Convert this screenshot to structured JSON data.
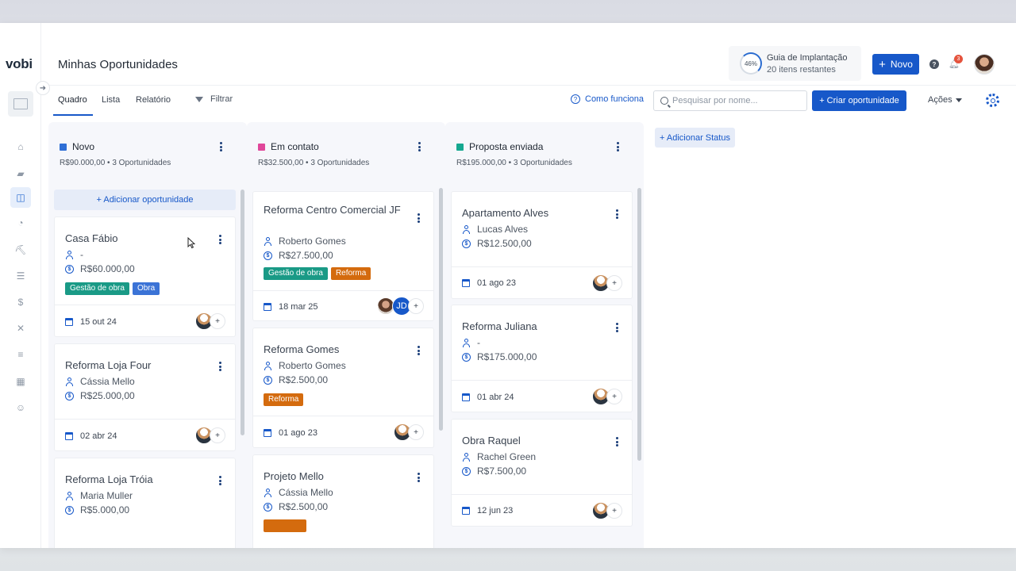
{
  "app": {
    "logo": "vobi",
    "page_title": "Minhas Oportunidades"
  },
  "guide": {
    "percent": "46%",
    "progress": 0.46,
    "title": "Guia de Implantação",
    "subtitle": "20 itens restantes"
  },
  "header": {
    "new_button": "Novo",
    "new_icon": "+",
    "help_icon": "?",
    "notification_count": "3"
  },
  "tabs": [
    {
      "label": "Quadro",
      "active": true
    },
    {
      "label": "Lista",
      "active": false
    },
    {
      "label": "Relatório",
      "active": false
    }
  ],
  "toolbar": {
    "filter_label": "Filtrar",
    "how_label": "Como funciona",
    "search_placeholder": "Pesquisar por nome...",
    "search_value": "",
    "create_label": "+ Criar oportunidade",
    "actions_label": "Ações"
  },
  "add_status_label": "+ Adicionar Status",
  "add_opportunity_label": "+ Adicionar oportunidade",
  "columns": [
    {
      "title": "Novo",
      "color": "#2f6fd6",
      "summary": "R$90.000,00 • 3 Oportunidades",
      "cards": [
        {
          "title": "Casa Fábio",
          "person": "-",
          "value": "R$60.000,00",
          "tags": [
            "Gestão de obra",
            "Obra"
          ],
          "date": "15 out 24"
        },
        {
          "title": "Reforma Loja Four",
          "person": "Cássia Mello",
          "value": "R$25.000,00",
          "tags": [],
          "date": "02 abr 24"
        },
        {
          "title": "Reforma Loja Tróia",
          "person": "Maria Muller",
          "value": "R$5.000,00",
          "tags": [],
          "date": ""
        }
      ]
    },
    {
      "title": "Em contato",
      "color": "#e0479a",
      "summary": "R$32.500,00 • 3 Oportunidades",
      "cards": [
        {
          "title": "Reforma Centro Comercial JF",
          "person": "Roberto Gomes",
          "value": "R$27.500,00",
          "tags": [
            "Gestão de obra",
            "Reforma"
          ],
          "date": "18 mar 25",
          "initials": "JD"
        },
        {
          "title": "Reforma Gomes",
          "person": "Roberto Gomes",
          "value": "R$2.500,00",
          "tags": [
            "Reforma"
          ],
          "date": "01 ago 23"
        },
        {
          "title": "Projeto Mello",
          "person": "Cássia Mello",
          "value": "R$2.500,00",
          "tags": [],
          "date": ""
        }
      ]
    },
    {
      "title": "Proposta enviada",
      "color": "#15a890",
      "summary": "R$195.000,00 • 3 Oportunidades",
      "cards": [
        {
          "title": "Apartamento Alves",
          "person": "Lucas Alves",
          "value": "R$12.500,00",
          "tags": [],
          "date": "01 ago 23"
        },
        {
          "title": "Reforma Juliana",
          "person": "-",
          "value": "R$175.000,00",
          "tags": [],
          "date": "01 abr 24"
        },
        {
          "title": "Obra Raquel",
          "person": "Rachel Green",
          "value": "R$7.500,00",
          "tags": [],
          "date": "12 jun 23"
        }
      ]
    }
  ],
  "sidebar_icons": [
    "home-icon",
    "folder-icon",
    "opportunities-icon",
    "dashboard-icon",
    "construction-icon",
    "database-icon",
    "finance-icon",
    "tools-icon",
    "list-icon",
    "apps-icon",
    "team-icon"
  ],
  "colors": {
    "primary": "#1758c9",
    "tag_green": "#1a9a86",
    "tag_blue": "#3b73d6",
    "tag_orange": "#d46b0e"
  }
}
